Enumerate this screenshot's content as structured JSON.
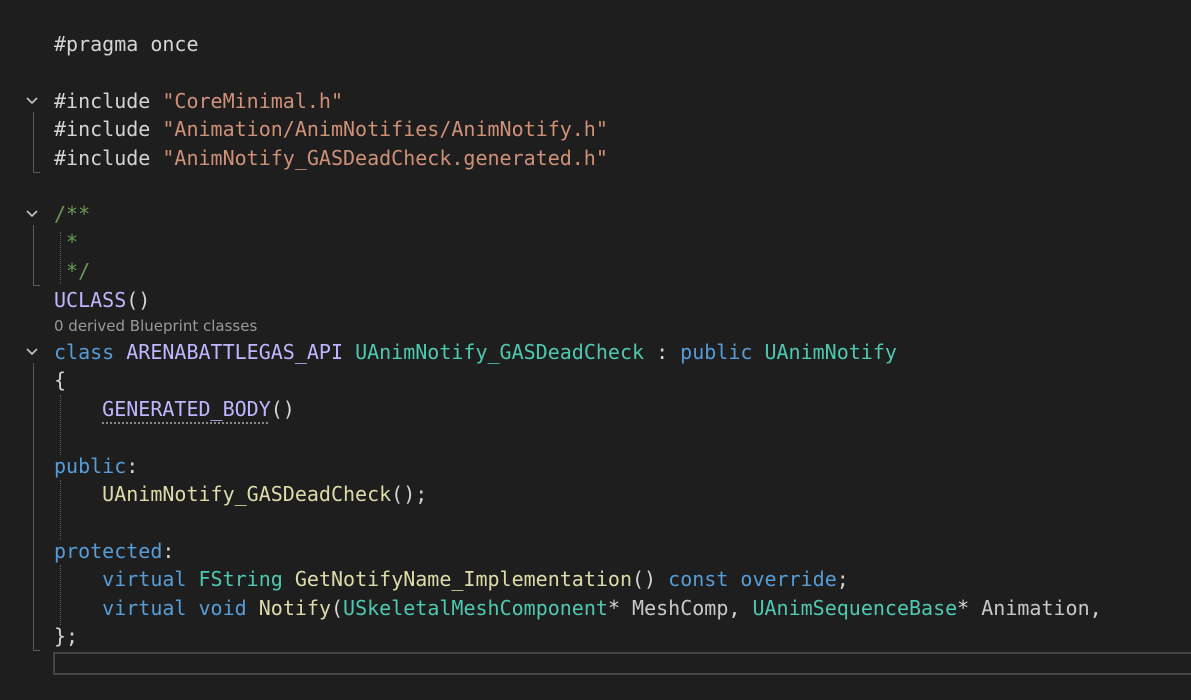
{
  "editor": {
    "lines": {
      "l1": {
        "pre": "#pragma once"
      },
      "l3": {
        "pre": "#include ",
        "str": "\"CoreMinimal.h\""
      },
      "l4": {
        "pre": "#include ",
        "str": "\"Animation/AnimNotifies/AnimNotify.h\""
      },
      "l5": {
        "pre": "#include ",
        "str": "\"AnimNotify_GASDeadCheck.generated.h\""
      },
      "l7": {
        "cmt": "/**"
      },
      "l8": {
        "cmt": " *"
      },
      "l9": {
        "cmt": " */"
      },
      "l10": {
        "macro": "UCLASS",
        "punct": "()"
      },
      "codelens": "0 derived Blueprint classes",
      "l11": {
        "kw": "class",
        "macro": "ARENABATTLEGAS_API",
        "type": "UAnimNotify_GASDeadCheck",
        "colon": " : ",
        "kw2": "public",
        "type2": "UAnimNotify"
      },
      "l12": {
        "punct": "{"
      },
      "l13": {
        "macro": "GENERATED_BODY",
        "punct": "()"
      },
      "l15": {
        "kw": "public",
        "punct": ":"
      },
      "l16": {
        "fn": "UAnimNotify_GASDeadCheck",
        "punct": "();"
      },
      "l18": {
        "kw": "protected",
        "punct": ":"
      },
      "l19": {
        "kw": "virtual",
        "type": "FString",
        "fn": "GetNotifyName_Implementation",
        "punct": "()",
        "kw2": "const",
        "kw3": "override",
        "end": ";"
      },
      "l20": {
        "kw": "virtual",
        "kw2": "void",
        "fn": "Notify",
        "p1": "(",
        "type": "USkeletalMeshComponent",
        "star1": "* ",
        "param1": "MeshComp",
        "comma1": ", ",
        "type2": "UAnimSequenceBase",
        "star2": "* ",
        "param2": "Animation",
        "comma2": ","
      },
      "l21": {
        "punct": "};"
      }
    }
  },
  "icons": {
    "fold": "chevron-down-icon"
  }
}
